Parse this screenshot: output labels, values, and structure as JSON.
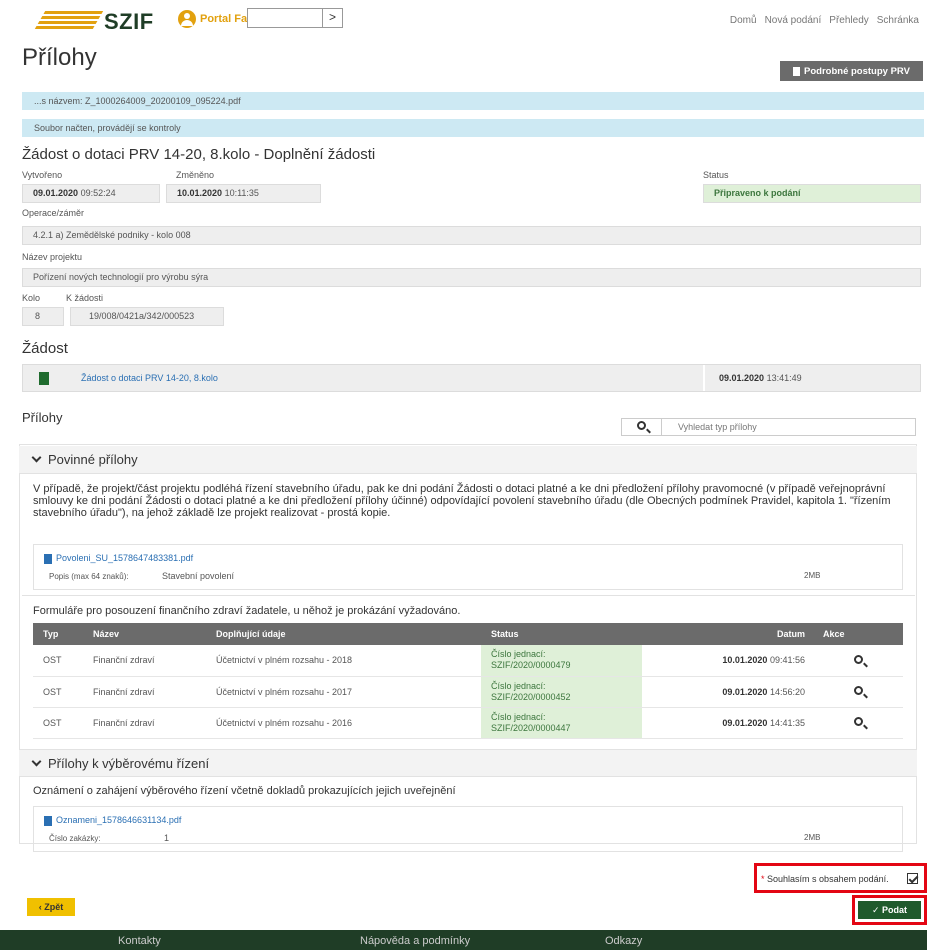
{
  "header": {
    "logo": "SZIF",
    "portal": "Portal Farmare",
    "search_btn": ">",
    "nav": [
      "Domů",
      "Nová podání",
      "Přehledy",
      "Schránka"
    ]
  },
  "page": {
    "title": "Přílohy",
    "postupy_btn": "Podrobné postupy PRV"
  },
  "info": {
    "file_line": "...s názvem: Z_1000264009_20200109_095224.pdf",
    "status_line": "Soubor načten, provádějí se kontroly"
  },
  "request": {
    "heading": "Žádost o dotaci PRV 14-20, 8.kolo - Doplnění žádosti",
    "created_label": "Vytvořeno",
    "created_date": "09.01.2020",
    "created_time": "09:52:24",
    "changed_label": "Změněno",
    "changed_date": "10.01.2020",
    "changed_time": "10:11:35",
    "status_label": "Status",
    "status_value": "Připraveno k podání",
    "operation_label": "Operace/záměr",
    "operation_value": "4.2.1 a) Zemědělské podniky - kolo 008",
    "project_label": "Název projektu",
    "project_value": "Pořízení nových technologií pro výrobu sýra",
    "round_label": "Kolo",
    "round_value": "8",
    "ref_label": "K žádosti",
    "ref_value": "19/008/0421a/342/000523"
  },
  "zadost": {
    "heading": "Žádost",
    "link": "Žádost o dotaci PRV 14-20, 8.kolo",
    "date": "09.01.2020",
    "time": "13:41:49"
  },
  "attachments": {
    "heading": "Přílohy",
    "search_placeholder": "Vyhledat typ přílohy",
    "mandatory": {
      "title": "Povinné přílohy",
      "description": "V případě, že projekt/část projektu podléhá řízení stavebního úřadu, pak ke dni podání Žádosti o dotaci platné a ke dni předložení přílohy pravomocné (v případě veřejnoprávní smlouvy ke dni podání Žádosti o dotaci platné a ke dni předložení přílohy účinné) odpovídající povolení stavebního úřadu (dle Obecných podmínek Pravidel, kapitola 1. \"řízením stavebního úřadu\"), na jehož základě lze projekt realizovat - prostá kopie.",
      "file_name": "Povoleni_SU_1578647483381.pdf",
      "file_desc_label": "Popis (max 64 znaků):",
      "file_desc_value": "Stavební povolení",
      "file_size": "2MB",
      "finance_heading": "Formuláře pro posouzení finančního zdraví žadatele, u něhož je prokázání vyžadováno.",
      "table": {
        "headers": [
          "Typ",
          "Název",
          "Doplňující údaje",
          "Status",
          "Datum",
          "Akce"
        ],
        "rows": [
          {
            "typ": "OST",
            "nazev": "Finanční zdraví",
            "udaje": "Účetnictví v plném rozsahu - 2018",
            "status_a": "Číslo jednací:",
            "status_b": "SZIF/2020/0000479",
            "date": "10.01.2020",
            "time": "09:41:56"
          },
          {
            "typ": "OST",
            "nazev": "Finanční zdraví",
            "udaje": "Účetnictví v plném rozsahu - 2017",
            "status_a": "Číslo jednací:",
            "status_b": "SZIF/2020/0000452",
            "date": "09.01.2020",
            "time": "14:56:20"
          },
          {
            "typ": "OST",
            "nazev": "Finanční zdraví",
            "udaje": "Účetnictví v plném rozsahu - 2016",
            "status_a": "Číslo jednací:",
            "status_b": "SZIF/2020/0000447",
            "date": "09.01.2020",
            "time": "14:41:35"
          }
        ]
      }
    },
    "tender": {
      "title": "Přílohy k výběrovému řízení",
      "subheading": "Oznámení o zahájení výběrového řízení včetně dokladů prokazujících jejich uveřejnění",
      "file_name": "Oznameni_1578646631134.pdf",
      "file_desc_label": "Číslo zakázky:",
      "file_desc_value": "1",
      "file_size": "2MB"
    }
  },
  "consent": {
    "star": "*",
    "label": "Souhlasím s obsahem podání."
  },
  "actions": {
    "back": "‹ Zpět",
    "submit": "✓ Podat"
  },
  "footer": {
    "links": [
      "Kontakty",
      "Nápověda a podmínky",
      "Odkazy"
    ]
  },
  "colors": {
    "brand_green": "#1f3d26",
    "accent_yellow": "#e2a10f",
    "info_blue": "#cde9f3",
    "status_green": "#dff0d8",
    "highlight_red": "#e30613"
  }
}
